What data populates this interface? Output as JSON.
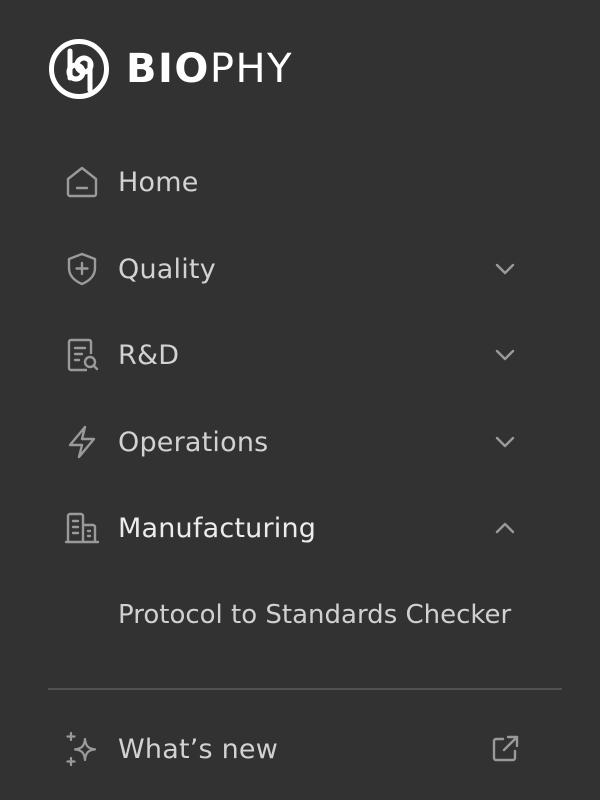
{
  "brand": {
    "name_bold": "BIO",
    "name_light": "PHY",
    "logo_icon": "biophy-logo-icon"
  },
  "nav": {
    "items": [
      {
        "label": "Home",
        "icon": "home-icon"
      },
      {
        "label": "Quality",
        "icon": "shield-plus-icon",
        "expanded": false
      },
      {
        "label": "R&D",
        "icon": "document-search-icon",
        "expanded": false
      },
      {
        "label": "Operations",
        "icon": "lightning-icon",
        "expanded": false
      },
      {
        "label": "Manufacturing",
        "icon": "building-icon",
        "expanded": true
      }
    ],
    "manufacturing_subitems": [
      {
        "label": "Protocol to Standards Checker"
      }
    ]
  },
  "footer": {
    "whats_new": {
      "label": "What’s new",
      "icon": "sparkles-icon",
      "action_icon": "external-link-icon"
    }
  },
  "colors": {
    "background": "#323232",
    "text": "#d2d2d2",
    "icon": "#9a9a9a",
    "divider": "#515151"
  }
}
